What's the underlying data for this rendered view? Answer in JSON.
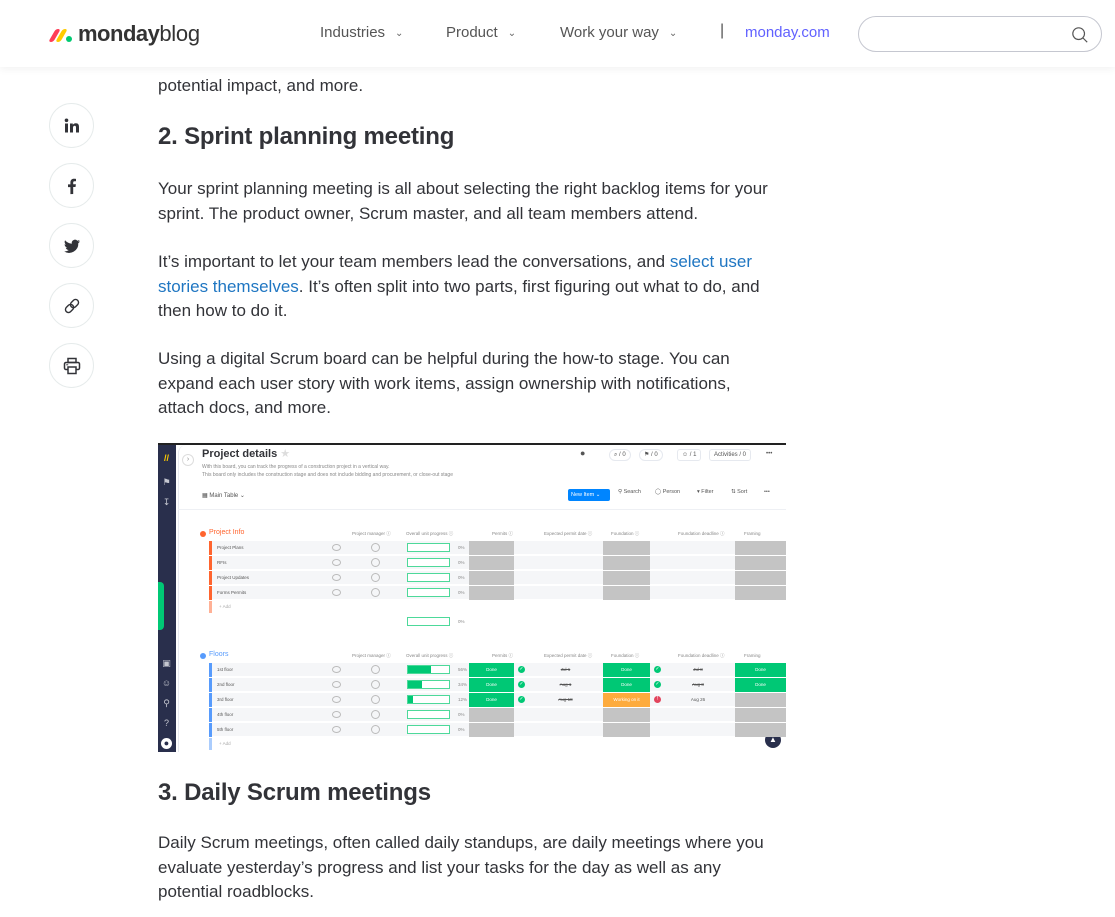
{
  "header": {
    "logo_bold": "monday",
    "logo_light": "blog",
    "logo_colors": [
      "#ff3d57",
      "#ffcb00",
      "#00ca72"
    ],
    "nav": [
      {
        "label": "Industries",
        "icon": "chevron-down-icon"
      },
      {
        "label": "Product",
        "icon": "chevron-down-icon"
      },
      {
        "label": "Work your way",
        "icon": "chevron-down-icon"
      }
    ],
    "separator": "|",
    "site_link": "monday.com",
    "search": {
      "value": "",
      "placeholder": "",
      "icon": "search-icon"
    }
  },
  "share": [
    {
      "name": "linkedin",
      "icon": "linkedin-icon"
    },
    {
      "name": "facebook",
      "icon": "facebook-icon"
    },
    {
      "name": "twitter",
      "icon": "twitter-icon"
    },
    {
      "name": "copy-link",
      "icon": "link-icon"
    },
    {
      "name": "print",
      "icon": "printer-icon"
    }
  ],
  "article": {
    "intro_tail": "potential impact, and more.",
    "section2": {
      "heading": "2. Sprint planning meeting",
      "p1": "Your sprint planning meeting is all about selecting the right backlog items for your sprint. The product owner, Scrum master, and all team members attend.",
      "p2_before": "It’s important to let your team members lead the conversations, and ",
      "p2_link": "select user stories themselves",
      "p2_after": ". It’s often split into two parts, first figuring out what to do, and then how to do it.",
      "p3": "Using a digital Scrum board can be helpful during the how-to stage. You can expand each user story with work items, assign ownership with notifications, attach docs, and more."
    },
    "section3": {
      "heading": "3. Daily Scrum meetings",
      "p1": "Daily Scrum meetings, often called daily standups, are daily meetings where you evaluate yesterday’s progress and list your tasks for the day as well as any potential roadblocks."
    }
  },
  "board": {
    "title": "Project details",
    "desc1": "With this board, you can track the progress of a construction project in a vertical way.",
    "desc2": "This board only includes the construction stage and does not include bidding and procurement, or close-out stage",
    "view": "Main Table",
    "top_actions": [
      "⌕ / 0",
      "⚑ / 0",
      "☺ / 1",
      "Activities / 0",
      "•••"
    ],
    "toolbar": {
      "new_item": "New Item",
      "search": "Search",
      "person": "Person",
      "filter": "Filter",
      "sort": "Sort",
      "more": "•••"
    },
    "columns": [
      "Project manager",
      "Overall unit progress",
      "Permits",
      "Expected permit date",
      "Foundation",
      "Foundation deadline",
      "Framing"
    ],
    "add_label": "+ Add",
    "groups": [
      {
        "name": "Project Info",
        "color": "#ff642e",
        "summary_progress": "0%",
        "rows": [
          {
            "name": "Project Plans",
            "progress": 0,
            "pct": "0%",
            "permits": "",
            "permit_date": "",
            "foundation": "",
            "foundation_deadline": "",
            "framing": ""
          },
          {
            "name": "RFIs",
            "progress": 0,
            "pct": "0%",
            "permits": "",
            "permit_date": "",
            "foundation": "",
            "foundation_deadline": "",
            "framing": ""
          },
          {
            "name": "Project Updates",
            "progress": 0,
            "pct": "0%",
            "permits": "",
            "permit_date": "",
            "foundation": "",
            "foundation_deadline": "",
            "framing": ""
          },
          {
            "name": "Forms Permits",
            "progress": 0,
            "pct": "0%",
            "permits": "",
            "permit_date": "",
            "foundation": "",
            "foundation_deadline": "",
            "framing": ""
          }
        ]
      },
      {
        "name": "Floors",
        "color": "#579bfc",
        "rows": [
          {
            "name": "1st floor",
            "progress": 56,
            "pct": "56%",
            "permits": "Done",
            "permit_date": "Jul 1",
            "permit_check": "done",
            "foundation": "Done",
            "foundation_deadline": "Jul 8",
            "foundation_check": "done",
            "framing": "Done"
          },
          {
            "name": "2nd floor",
            "progress": 34,
            "pct": "34%",
            "permits": "Done",
            "permit_date": "Aug 1",
            "permit_check": "done",
            "foundation": "Done",
            "foundation_deadline": "Aug 8",
            "foundation_check": "done",
            "framing": "Done"
          },
          {
            "name": "3rd floor",
            "progress": 12,
            "pct": "12%",
            "permits": "Done",
            "permit_date": "Aug 18",
            "permit_check": "done",
            "foundation": "Working on it",
            "foundation_deadline": "Aug 26",
            "foundation_check": "alert",
            "framing": ""
          },
          {
            "name": "4th floor",
            "progress": 0,
            "pct": "0%",
            "permits": "",
            "permit_date": "",
            "foundation": "",
            "foundation_deadline": "",
            "framing": ""
          },
          {
            "name": "5th floor",
            "progress": 0,
            "pct": "0%",
            "permits": "",
            "permit_date": "",
            "foundation": "",
            "foundation_deadline": "",
            "framing": ""
          }
        ]
      }
    ]
  }
}
